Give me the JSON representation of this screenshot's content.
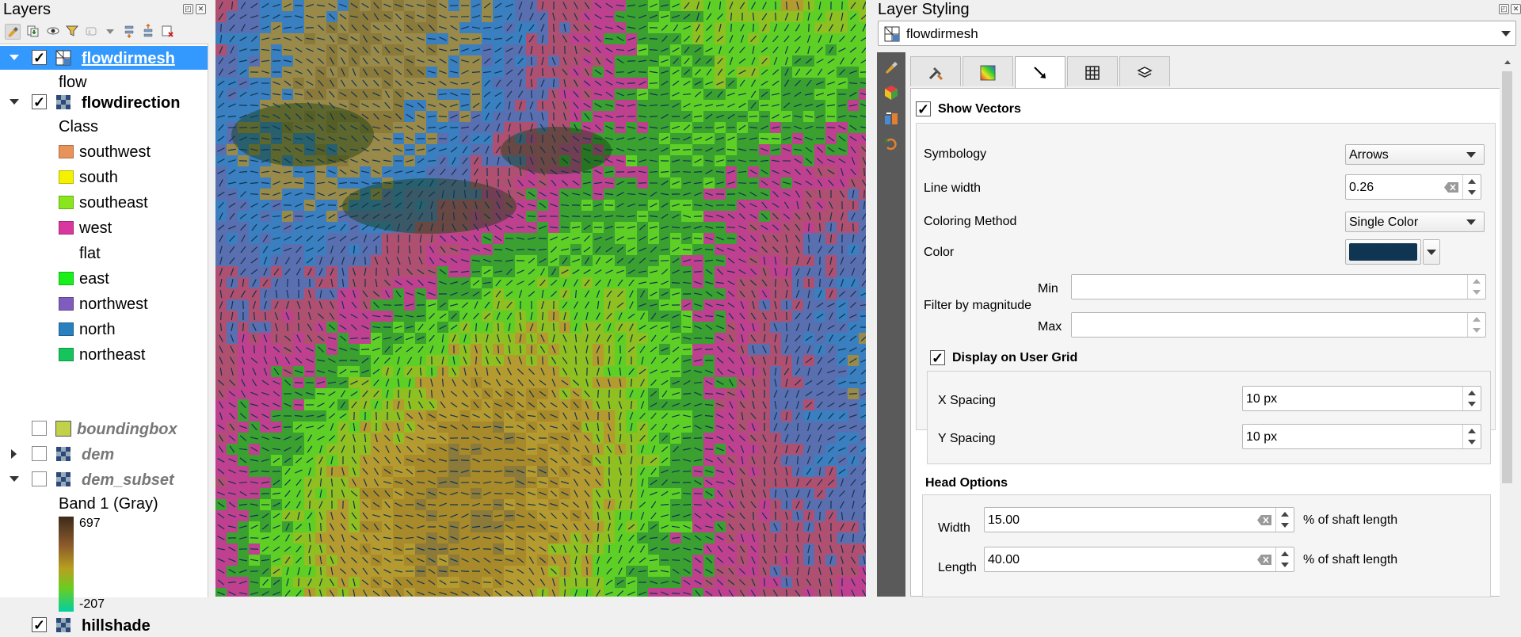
{
  "layers_panel": {
    "title": "Layers",
    "tree": {
      "flowdirmesh": {
        "name": "flowdirmesh",
        "sub": "flow"
      },
      "flowdirection": {
        "name": "flowdirection",
        "class_header": "Class",
        "classes": [
          {
            "label": "southwest",
            "color": "#e8935a"
          },
          {
            "label": "south",
            "color": "#f5f200"
          },
          {
            "label": "southeast",
            "color": "#8ae61c"
          },
          {
            "label": "west",
            "color": "#d9379e"
          },
          {
            "label": "flat",
            "color": "none"
          },
          {
            "label": "east",
            "color": "#19f019"
          },
          {
            "label": "northwest",
            "color": "#7f5cbd"
          },
          {
            "label": "north",
            "color": "#2a7fbf"
          },
          {
            "label": "northeast",
            "color": "#16c45c"
          }
        ]
      },
      "boundingbox": {
        "name": "boundingbox",
        "color": "#c2d14a"
      },
      "dem": {
        "name": "dem"
      },
      "dem_subset": {
        "name": "dem_subset",
        "band_label": "Band 1 (Gray)",
        "max": "697",
        "min": "-207"
      },
      "hillshade": {
        "name": "hillshade"
      }
    }
  },
  "styling_panel": {
    "title": "Layer Styling",
    "selected_layer": "flowdirmesh",
    "show_vectors": {
      "label": "Show Vectors",
      "checked": true
    },
    "fields": {
      "symbology_label": "Symbology",
      "symbology_value": "Arrows",
      "line_width_label": "Line width",
      "line_width_value": "0.26",
      "coloring_label": "Coloring Method",
      "coloring_value": "Single Color",
      "color_label": "Color",
      "color_value": "#0f3553",
      "filter_label": "Filter by magnitude",
      "min_label": "Min",
      "max_label": "Max",
      "min_value": "",
      "max_value": ""
    },
    "user_grid": {
      "label": "Display on User Grid",
      "checked": true,
      "x_label": "X Spacing",
      "x_value": "10 px",
      "y_label": "Y Spacing",
      "y_value": "10 px"
    },
    "head_options": {
      "title": "Head Options",
      "width_label": "Width",
      "width_value": "15.00",
      "length_label": "Length",
      "length_value": "40.00",
      "unit": "% of shaft length"
    }
  }
}
